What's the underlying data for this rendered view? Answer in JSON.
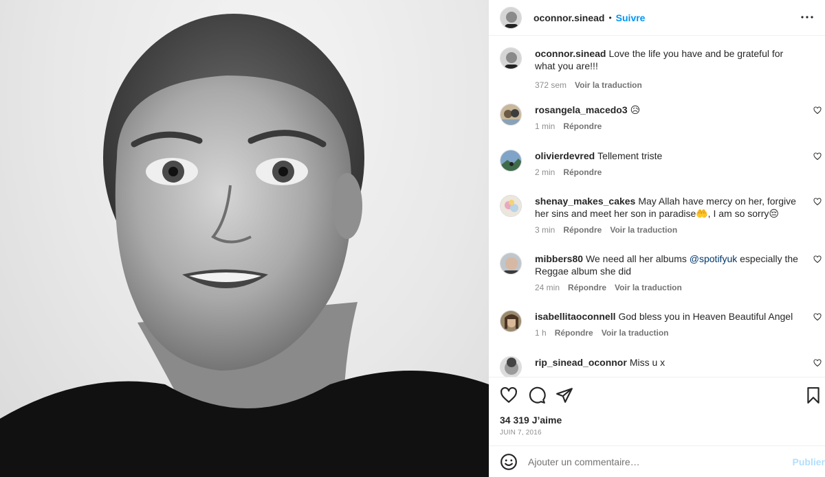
{
  "post": {
    "username": "oconnor.sinead",
    "separator": "•",
    "follow_label": "Suivre"
  },
  "caption": {
    "username": "oconnor.sinead",
    "text": "Love the life you have and be grateful for what you are!!!",
    "time": "372 sem",
    "translate": "Voir la traduction"
  },
  "comments": [
    {
      "username": "rosangela_macedo3",
      "text": "😥",
      "time": "1 min",
      "reply": "Répondre"
    },
    {
      "username": "olivierdevred",
      "text": "Tellement triste",
      "time": "2 min",
      "reply": "Répondre"
    },
    {
      "username": "shenay_makes_cakes",
      "text": "May Allah have mercy on her, forgive her sins and meet her son in paradise🤲, I am so sorry😔",
      "time": "3 min",
      "reply": "Répondre",
      "translate": "Voir la traduction"
    },
    {
      "username": "mibbers80",
      "text_before": "We need all her albums ",
      "mention": "@spotifyuk",
      "text_after": " especially the Reggae album she did",
      "time": "24 min",
      "reply": "Répondre",
      "translate": "Voir la traduction"
    },
    {
      "username": "isabellitaoconnell",
      "text": "God bless you in Heaven Beautiful Angel",
      "time": "1 h",
      "reply": "Répondre",
      "translate": "Voir la traduction"
    },
    {
      "username": "rip_sinead_oconnor",
      "text": "Miss u x"
    }
  ],
  "footer": {
    "likes": "34 319 J’aime",
    "date": "JUIN 7, 2016",
    "comment_placeholder": "Ajouter un commentaire…",
    "publish_label": "Publier"
  },
  "icons": {
    "more": "more-horizontal-icon",
    "like": "heart-icon",
    "comment": "comment-bubble-icon",
    "share": "paper-plane-icon",
    "save": "bookmark-icon",
    "emoji": "smiley-icon"
  },
  "colors": {
    "link_blue": "#0095f6",
    "mention": "#00376b",
    "publish_disabled": "#b2dffc",
    "secondary_text": "#8e8e8e"
  }
}
